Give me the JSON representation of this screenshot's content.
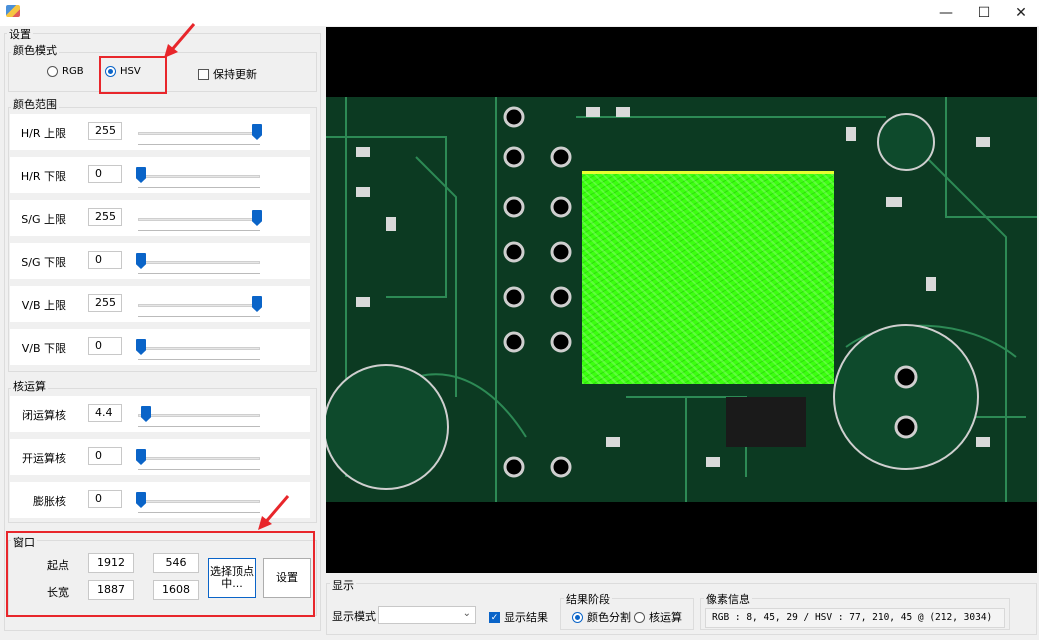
{
  "window": {
    "minimize": "—",
    "maximize": "☐",
    "close": "✕"
  },
  "settings": {
    "title": "设置",
    "color_mode": {
      "title": "颜色模式",
      "rgb_label": "RGB",
      "hsv_label": "HSV",
      "selected": "HSV",
      "keep_update_label": "保持更新",
      "keep_update_checked": false
    },
    "color_range": {
      "title": "颜色范围",
      "rows": [
        {
          "label": "H/R 上限",
          "value": "255",
          "level": 1.0
        },
        {
          "label": "H/R 下限",
          "value": "0",
          "level": 0.0
        },
        {
          "label": "S/G 上限",
          "value": "255",
          "level": 1.0
        },
        {
          "label": "S/G 下限",
          "value": "0",
          "level": 0.0
        },
        {
          "label": "V/B 上限",
          "value": "255",
          "level": 1.0
        },
        {
          "label": "V/B 下限",
          "value": "0",
          "level": 0.0
        }
      ]
    },
    "kernel": {
      "title": "核运算",
      "rows": [
        {
          "label": "闭运算核",
          "value": "4.4",
          "level": 0.04
        },
        {
          "label": "开运算核",
          "value": "0",
          "level": 0.0
        },
        {
          "label": "膨胀核",
          "value": "0",
          "level": 0.0
        }
      ]
    },
    "window_group": {
      "title": "窗口",
      "origin_label": "起点",
      "origin_x": "1912",
      "origin_y": "546",
      "size_label": "长宽",
      "width": "1887",
      "height": "1608",
      "select_vertex_button": "选择顶点中...",
      "set_button": "设置"
    }
  },
  "display": {
    "title": "显示",
    "mode_label": "显示模式",
    "mode_value": "",
    "show_result_label": "显示结果",
    "show_result_checked": true,
    "result_stage": {
      "title": "结果阶段",
      "color_seg_label": "颜色分割",
      "kernel_calc_label": "核运算",
      "selected": "颜色分割"
    },
    "pixel_info": {
      "title": "像素信息",
      "text": "RGB : 8, 45, 29 / HSV : 77, 210, 45 @ (212, 3034)"
    }
  },
  "colors": {
    "accent": "#0a64c8",
    "annotation_red": "#e8262b",
    "mask_green": "#3cff10",
    "pcb_green": "#0c3a22"
  }
}
